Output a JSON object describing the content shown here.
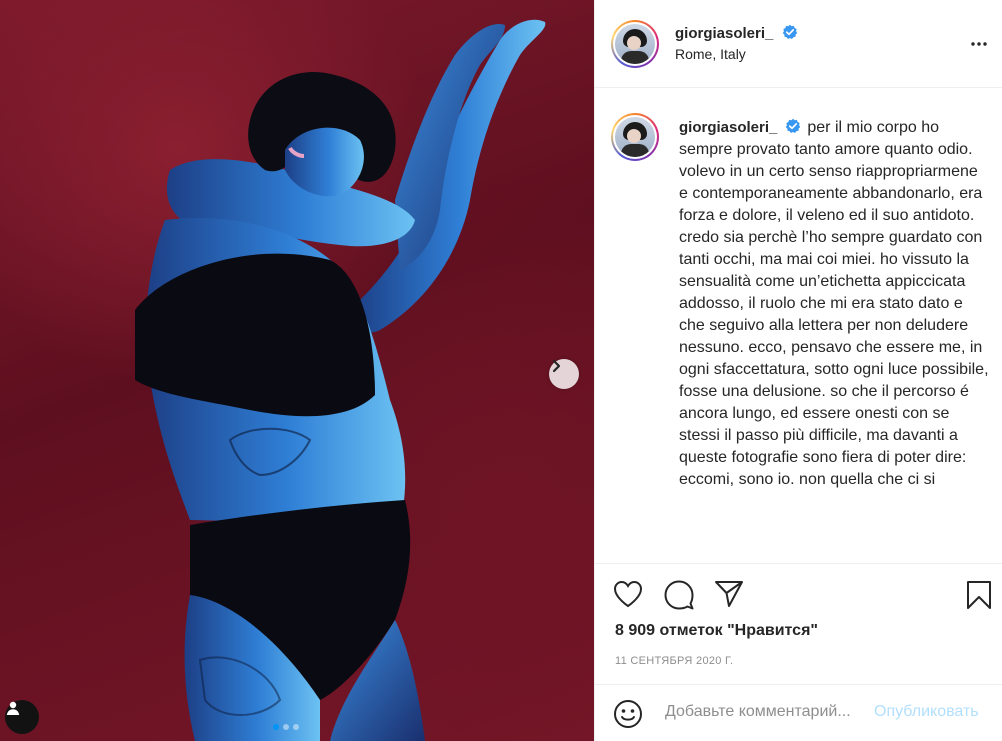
{
  "post": {
    "username": "giorgiasoleri_",
    "location": "Rome, Italy",
    "caption": "per il mio corpo ho sempre provato tanto amore quanto odio. volevo in un certo senso riappropriarmene e contemporaneamente abbandonarlo, era forza e dolore, il veleno ed il suo antidoto. credo sia perchè l’ho sempre guardato con tanti occhi, ma mai coi miei. ho vissuto la sensualità come un’etichetta appiccicata addosso, il ruolo che mi era stato dato e che seguivo alla lettera per non deludere nessuno. ecco, pensavo che essere me, in ogni sfaccettatura, sotto ogni luce possibile, fosse una delusione. so che il percorso é ancora lungo, ed essere onesti con se stessi il passo più difficile, ma davanti a queste fotografie sono fiera di poter dire: eccomi, sono io. non quella che ci si",
    "likes": "8 909 отметок \"Нравится\"",
    "date": "11 сентября 2020 г."
  },
  "comment": {
    "placeholder": "Добавьте комментарий...",
    "publish_label": "Опубликовать"
  },
  "carousel": {
    "count": 3,
    "active": 0
  },
  "icons": {
    "like": "heart-icon",
    "comment": "comment-icon",
    "share": "paper-plane-icon",
    "save": "bookmark-icon",
    "emoji": "emoji-icon",
    "more": "more-icon",
    "verified": "verified-badge-icon",
    "next": "chevron-right-icon",
    "tagged_users": "user-icon"
  },
  "colors": {
    "verified": "#3897f0",
    "publish_disabled": "#b2dffc",
    "carousel_active": "#0095f6",
    "muted_text": "#8e8e8e"
  }
}
